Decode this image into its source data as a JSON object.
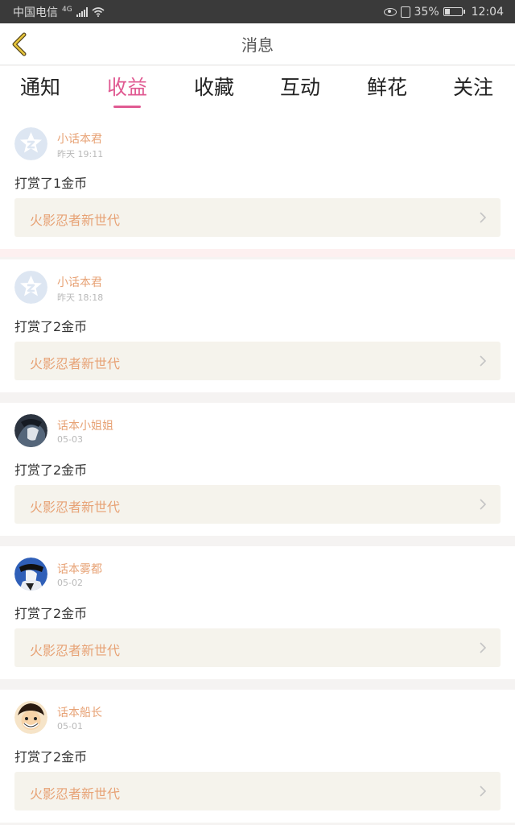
{
  "status_bar": {
    "carrier": "中国电信",
    "network": "4G",
    "battery": "35%",
    "battery_level": 0.35,
    "time": "12:04"
  },
  "header": {
    "title": "消息"
  },
  "tabs": [
    {
      "label": "通知",
      "active": false
    },
    {
      "label": "收益",
      "active": true
    },
    {
      "label": "收藏",
      "active": false
    },
    {
      "label": "互动",
      "active": false
    },
    {
      "label": "鲜花",
      "active": false
    },
    {
      "label": "关注",
      "active": false
    }
  ],
  "colors": {
    "accent_pink": "#e05a92",
    "name_orange": "#e7a275",
    "link_bg": "#f5f3ec"
  },
  "messages": [
    {
      "user": "小话本君",
      "time": "昨天 19:11",
      "action": "打赏了1金币",
      "work": "火影忍者新世代",
      "avatar_icon": "default-avatar-icon"
    },
    {
      "user": "小话本君",
      "time": "昨天 18:18",
      "action": "打赏了2金币",
      "work": "火影忍者新世代",
      "avatar_icon": "default-avatar-icon"
    },
    {
      "user": "话本小姐姐",
      "time": "05-03",
      "action": "打赏了2金币",
      "work": "火影忍者新世代",
      "avatar_icon": "anime-avatar-icon"
    },
    {
      "user": "话本雾都",
      "time": "05-02",
      "action": "打赏了2金币",
      "work": "火影忍者新世代",
      "avatar_icon": "anime-avatar-icon"
    },
    {
      "user": "话本船长",
      "time": "05-01",
      "action": "打赏了2金币",
      "work": "火影忍者新世代",
      "avatar_icon": "anime-avatar-icon"
    }
  ]
}
